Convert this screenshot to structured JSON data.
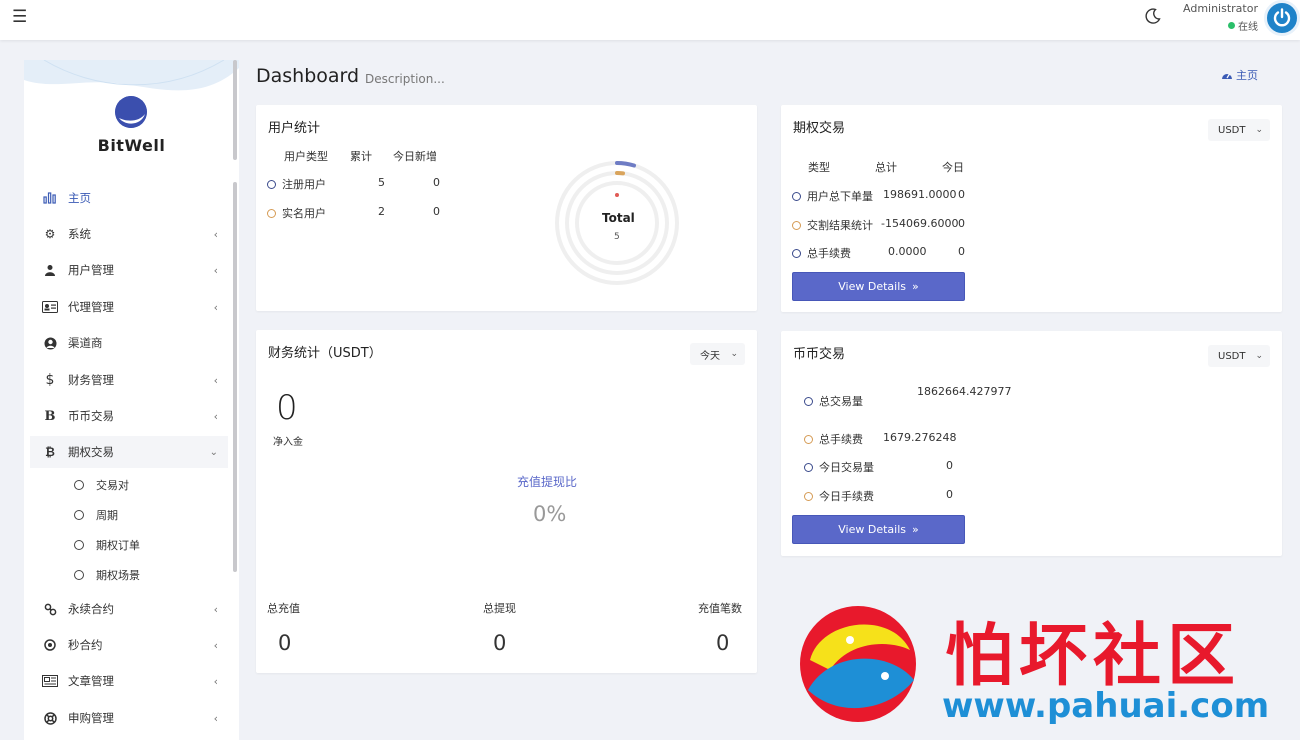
{
  "topbar": {
    "admin_name": "Administrator",
    "admin_status": "在线"
  },
  "sidebar": {
    "logo_text": "BitWell",
    "items": [
      {
        "label": "主页",
        "icon": "bar-chart-icon"
      },
      {
        "label": "系统",
        "icon": "gear-icon"
      },
      {
        "label": "用户管理",
        "icon": "user-icon"
      },
      {
        "label": "代理管理",
        "icon": "id-card-icon"
      },
      {
        "label": "渠道商",
        "icon": "user-circle-icon"
      },
      {
        "label": "财务管理",
        "icon": "dollar-icon"
      },
      {
        "label": "币币交易",
        "icon": "bold-b-icon"
      },
      {
        "label": "期权交易",
        "icon": "bitcoin-icon"
      },
      {
        "label": "永续合约",
        "icon": "link-icon"
      },
      {
        "label": "秒合约",
        "icon": "dot-circle-icon"
      },
      {
        "label": "文章管理",
        "icon": "newspaper-icon"
      },
      {
        "label": "申购管理",
        "icon": "life-ring-icon"
      }
    ],
    "sub_items": [
      "交易对",
      "周期",
      "期权订单",
      "期权场景"
    ]
  },
  "header": {
    "title": "Dashboard",
    "description": "Description...",
    "breadcrumb": "主页"
  },
  "user_stats": {
    "title": "用户统计",
    "columns": [
      "用户类型",
      "累计",
      "今日新增"
    ],
    "rows": [
      {
        "type": "注册用户",
        "total": "5",
        "today": "0"
      },
      {
        "type": "实名用户",
        "total": "2",
        "today": "0"
      }
    ],
    "donut_label": "Total",
    "donut_value": "5"
  },
  "options": {
    "title": "期权交易",
    "currency": "USDT",
    "columns": [
      "类型",
      "总计",
      "今日"
    ],
    "rows": [
      {
        "type": "用户总下单量",
        "total": "198691.0000",
        "today": "0"
      },
      {
        "type": "交割结果统计",
        "total": "-154069.6000",
        "today": "0"
      },
      {
        "type": "总手续费",
        "total": "0.0000",
        "today": "0"
      }
    ],
    "button": "View Details"
  },
  "finance": {
    "title": "财务统计（USDT）",
    "period": "今天",
    "net_value": "0",
    "net_label": "净入金",
    "ratio_label": "充值提现比",
    "ratio_value": "0%",
    "totals": [
      {
        "label": "总充值",
        "value": "0"
      },
      {
        "label": "总提现",
        "value": "0"
      },
      {
        "label": "充值笔数",
        "value": "0"
      }
    ]
  },
  "spot": {
    "title": "币币交易",
    "currency": "USDT",
    "rows": [
      {
        "type": "总交易量",
        "value": "1862664.427977"
      },
      {
        "type": "总手续费",
        "value": "1679.276248"
      },
      {
        "type": "今日交易量",
        "value": "0"
      },
      {
        "type": "今日手续费",
        "value": "0"
      }
    ],
    "button": "View Details"
  },
  "watermark": {
    "title": "怕坏社区",
    "url": "www.pahuai.com"
  },
  "colors": {
    "accent": "#3b5bb5",
    "button": "#5a68c9",
    "online": "#2bbf6a",
    "ring_orange": "#d59b54",
    "ring_blue": "#3b4b8c"
  }
}
